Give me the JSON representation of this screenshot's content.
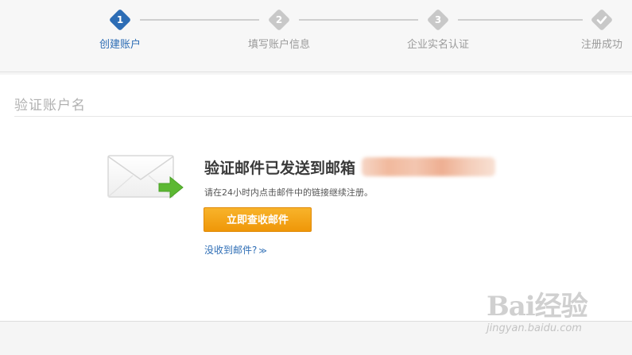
{
  "steps": [
    {
      "number": "1",
      "label": "创建账户",
      "state": "active"
    },
    {
      "number": "2",
      "label": "填写账户信息",
      "state": "inactive"
    },
    {
      "number": "3",
      "label": "企业实名认证",
      "state": "inactive"
    },
    {
      "number": "",
      "label": "注册成功",
      "state": "done-icon"
    }
  ],
  "section": {
    "title": "验证账户名"
  },
  "verify": {
    "heading": "验证邮件已发送到邮箱",
    "instruction": "请在24小时内点击邮件中的链接继续注册。",
    "check_mail_button": "立即查收邮件",
    "not_received_link": "没收到邮件?"
  },
  "watermark": {
    "main": "Bai经验",
    "sub": "jingyan.baidu.com"
  },
  "colors": {
    "accent": "#2d6db5",
    "button": "#f5a623",
    "inactive": "#c8c8c8"
  }
}
